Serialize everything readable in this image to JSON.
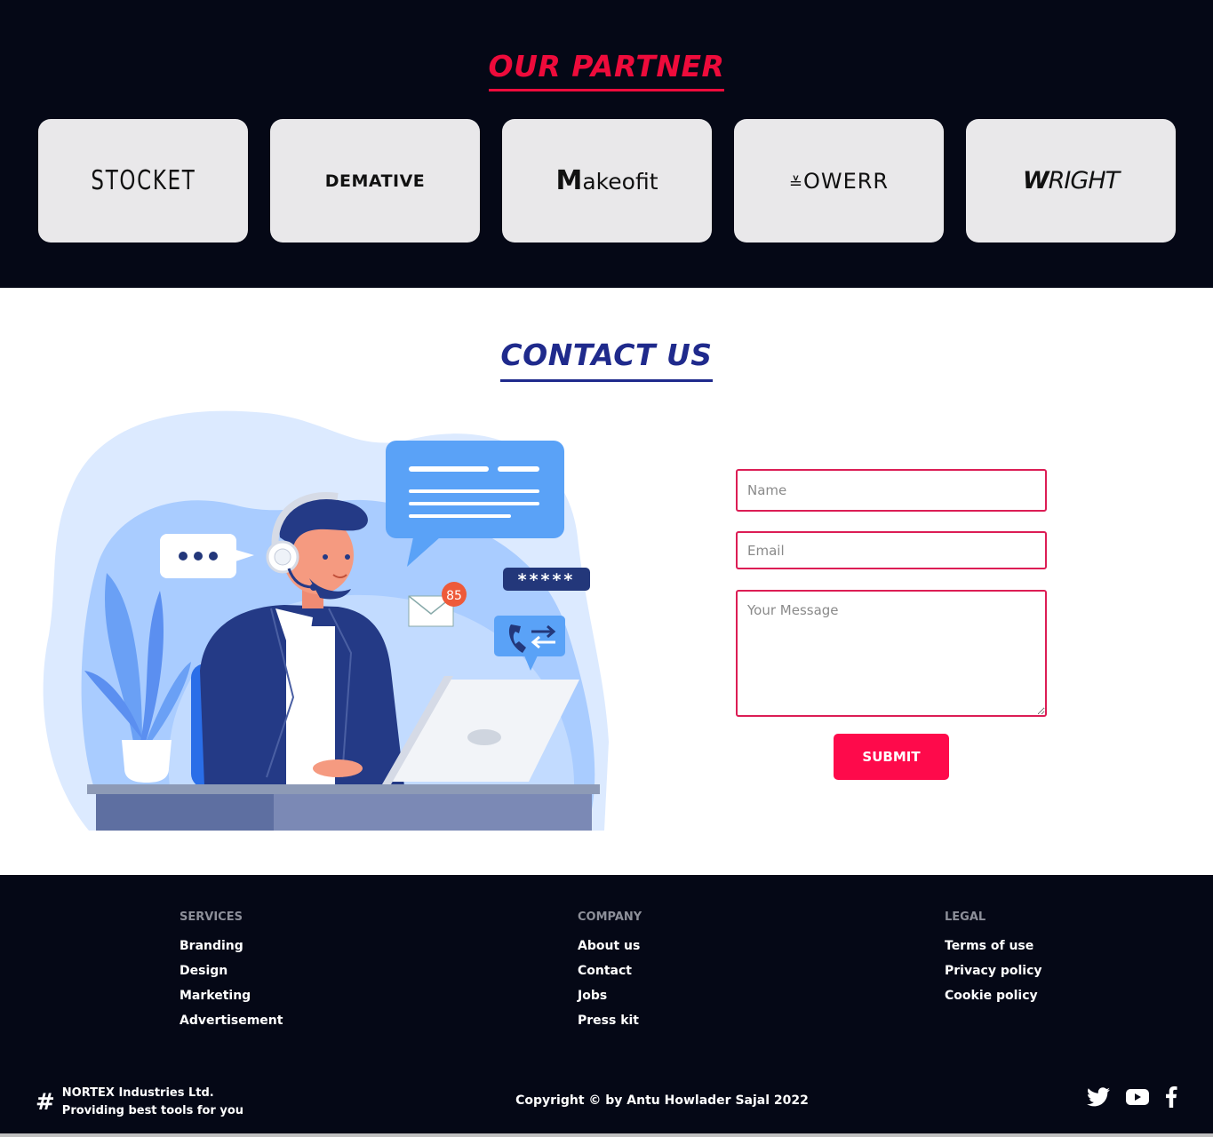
{
  "partner": {
    "title": "OUR PARTNER",
    "logos": [
      {
        "name": "STOCKET"
      },
      {
        "name": "DEMATIVE"
      },
      {
        "prefix": "M",
        "name": "akeofit"
      },
      {
        "name": "OWERR"
      },
      {
        "prefix": "W",
        "name": "RIGHT"
      }
    ]
  },
  "contact": {
    "title": "CONTACT US",
    "illustration": {
      "badge_count": "85",
      "password_mask": "*****"
    },
    "form": {
      "name_placeholder": "Name",
      "email_placeholder": "Email",
      "message_placeholder": "Your Message",
      "submit_label": "SUBMIT"
    }
  },
  "footer": {
    "columns": [
      {
        "heading": "SERVICES",
        "links": [
          "Branding",
          "Design",
          "Marketing",
          "Advertisement"
        ]
      },
      {
        "heading": "COMPANY",
        "links": [
          "About us",
          "Contact",
          "Jobs",
          "Press kit"
        ]
      },
      {
        "heading": "LEGAL",
        "links": [
          "Terms of use",
          "Privacy policy",
          "Cookie policy"
        ]
      }
    ],
    "brand": {
      "line1": "NORTEX Industries Ltd.",
      "line2": "Providing best tools for you"
    },
    "copyright": "Copyright © by Antu Howlader Sajal 2022",
    "social": [
      "twitter-icon",
      "youtube-icon",
      "facebook-icon"
    ]
  },
  "colors": {
    "accent_red": "#ee0b3b",
    "accent_blue": "#1f2a8c",
    "dark_bg": "#050816",
    "submit_bg": "#fe0a4b"
  }
}
